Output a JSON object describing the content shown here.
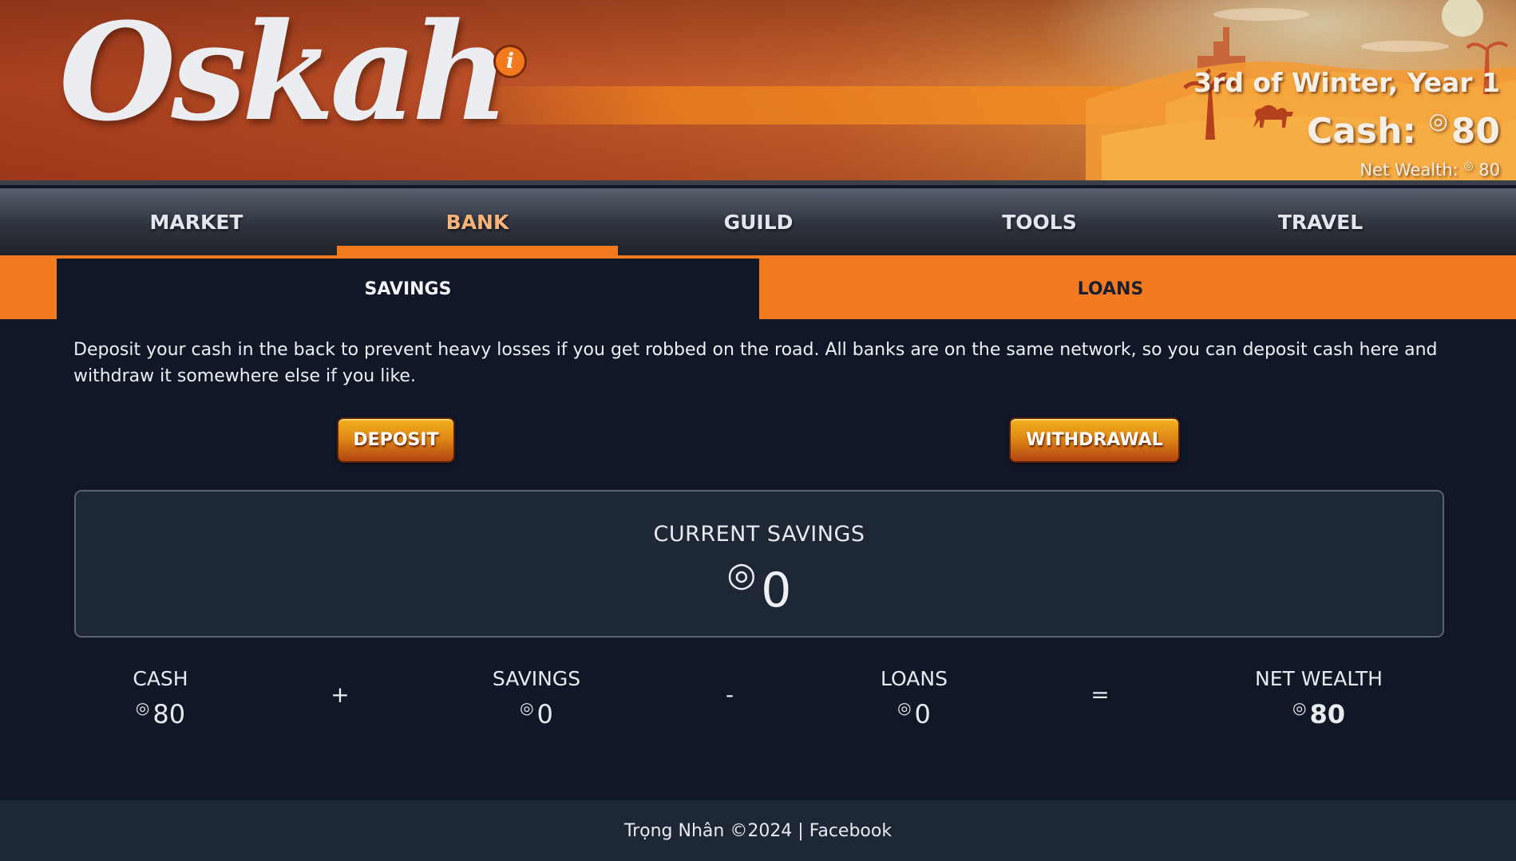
{
  "header": {
    "logo_text": "Oskah",
    "info_icon_glyph": "i",
    "date": "3rd of Winter, Year 1",
    "cash_label": "Cash:",
    "cash_value": "80",
    "net_wealth_label": "Net Wealth:",
    "net_wealth_value": "80",
    "coin_glyph": "◎"
  },
  "nav": {
    "tabs": [
      {
        "label": "MARKET"
      },
      {
        "label": "BANK"
      },
      {
        "label": "GUILD"
      },
      {
        "label": "TOOLS"
      },
      {
        "label": "TRAVEL"
      }
    ],
    "active": "BANK"
  },
  "subnav": {
    "tabs": [
      {
        "label": "SAVINGS"
      },
      {
        "label": "LOANS"
      }
    ],
    "active": "SAVINGS"
  },
  "savings": {
    "description": "Deposit your cash in the back to prevent heavy losses if you get robbed on the road. All banks are on the same network, so you can deposit cash here and withdraw it somewhere else if you like.",
    "deposit_label": "DEPOSIT",
    "withdrawal_label": "WITHDRAWAL",
    "current_label": "CURRENT SAVINGS",
    "current_value": "0"
  },
  "summary": {
    "items": [
      {
        "label": "CASH",
        "value": "80"
      },
      {
        "label": "SAVINGS",
        "value": "0"
      },
      {
        "label": "LOANS",
        "value": "0"
      },
      {
        "label": "NET WEALTH",
        "value": "80"
      }
    ],
    "operators": [
      "+",
      "-",
      "="
    ]
  },
  "footer": {
    "author": "Trọng Nhân ©2024 |",
    "link": "Facebook"
  },
  "colors": {
    "accent": "#f47a1f",
    "background": "#101828",
    "panel": "#1e2736"
  }
}
